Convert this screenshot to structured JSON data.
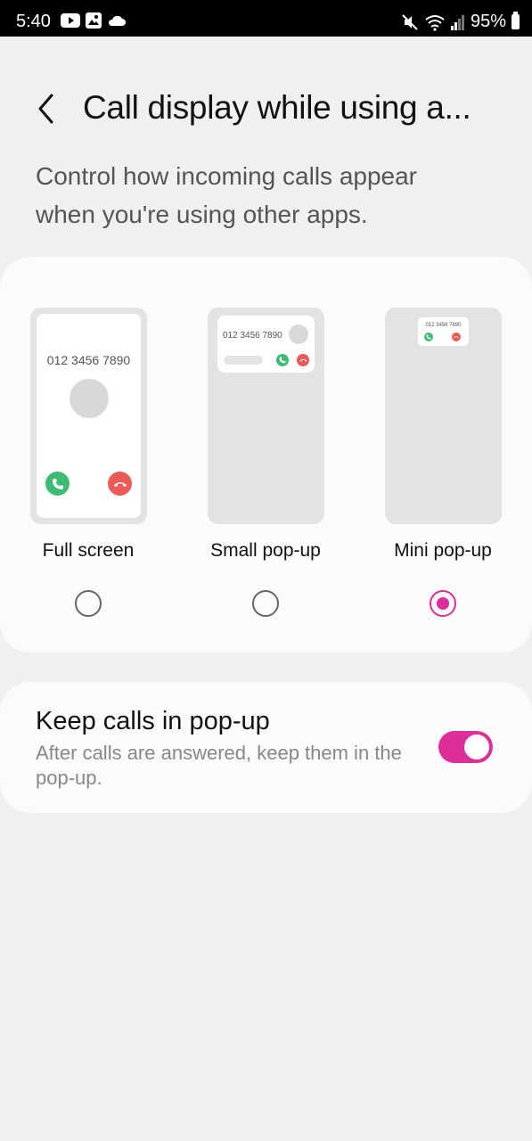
{
  "status_bar": {
    "time": "5:40",
    "battery": "95%"
  },
  "header": {
    "title": "Call display while using a...",
    "description": "Control how incoming calls appear when you're using other apps."
  },
  "display_options": {
    "selected": "mini",
    "sample_number": "012 3456 7890",
    "options": [
      {
        "label": "Full screen",
        "checked": false
      },
      {
        "label": "Small pop-up",
        "checked": false
      },
      {
        "label": "Mini pop-up",
        "checked": true
      }
    ]
  },
  "keep_calls": {
    "title": "Keep calls in pop-up",
    "subtitle": "After calls are answered, keep them in the pop-up.",
    "enabled": true
  },
  "colors": {
    "accent": "#dd2e9a",
    "accept": "#3dbb73",
    "decline": "#ea5b57",
    "background": "#f0f0f0",
    "card": "#fbfbfb"
  }
}
